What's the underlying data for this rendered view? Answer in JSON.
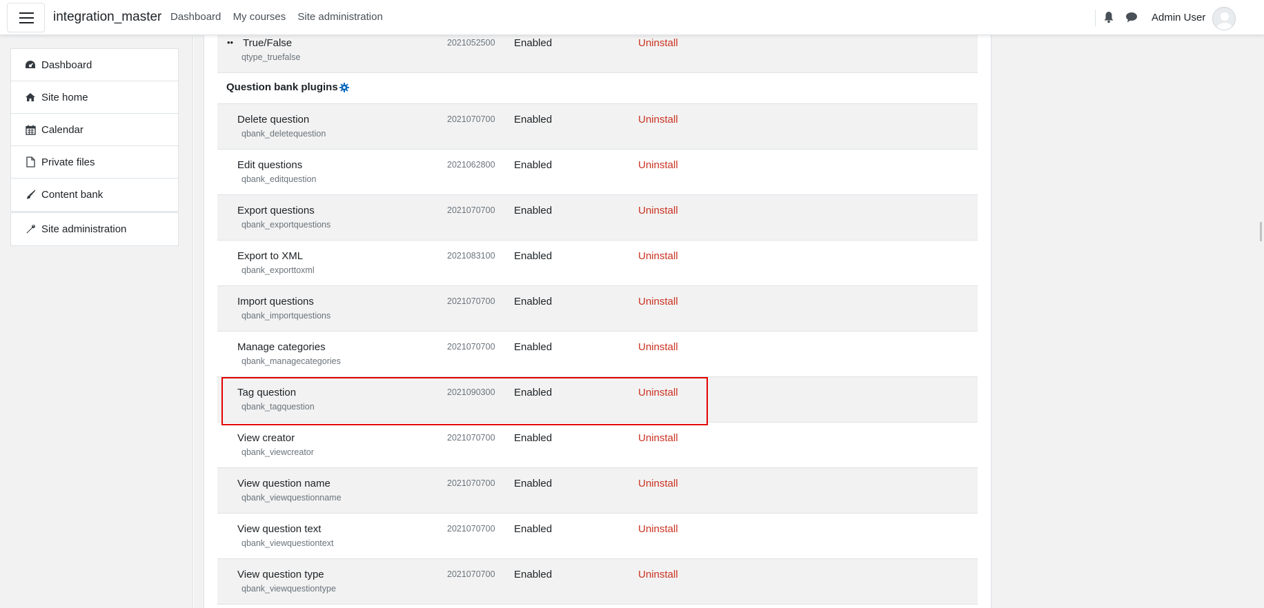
{
  "navbar": {
    "brand": "integration_master",
    "links": [
      "Dashboard",
      "My courses",
      "Site administration"
    ],
    "user_name": "Admin User",
    "icons": [
      "menu-icon",
      "bell-icon",
      "chat-icon",
      "avatar"
    ]
  },
  "drawer": {
    "group1": [
      {
        "label": "Dashboard",
        "icon": "dashboard-icon"
      },
      {
        "label": "Site home",
        "icon": "home-icon"
      },
      {
        "label": "Calendar",
        "icon": "calendar-icon"
      },
      {
        "label": "Private files",
        "icon": "file-icon"
      },
      {
        "label": "Content bank",
        "icon": "brush-icon"
      }
    ],
    "group2": [
      {
        "label": "Site administration",
        "icon": "wrench-icon"
      }
    ]
  },
  "top_row": {
    "bullet": "••",
    "name": "True/False",
    "component": "qtype_truefalse",
    "version": "2021052500",
    "status": "Enabled",
    "action": "Uninstall"
  },
  "section": {
    "title": "Question bank plugins"
  },
  "plugins": [
    {
      "name": "Delete question",
      "component": "qbank_deletequestion",
      "version": "2021070700",
      "status": "Enabled",
      "action": "Uninstall"
    },
    {
      "name": "Edit questions",
      "component": "qbank_editquestion",
      "version": "2021062800",
      "status": "Enabled",
      "action": "Uninstall"
    },
    {
      "name": "Export questions",
      "component": "qbank_exportquestions",
      "version": "2021070700",
      "status": "Enabled",
      "action": "Uninstall"
    },
    {
      "name": "Export to XML",
      "component": "qbank_exporttoxml",
      "version": "2021083100",
      "status": "Enabled",
      "action": "Uninstall"
    },
    {
      "name": "Import questions",
      "component": "qbank_importquestions",
      "version": "2021070700",
      "status": "Enabled",
      "action": "Uninstall"
    },
    {
      "name": "Manage categories",
      "component": "qbank_managecategories",
      "version": "2021070700",
      "status": "Enabled",
      "action": "Uninstall"
    },
    {
      "name": "Tag question",
      "component": "qbank_tagquestion",
      "version": "2021090300",
      "status": "Enabled",
      "action": "Uninstall"
    },
    {
      "name": "View creator",
      "component": "qbank_viewcreator",
      "version": "2021070700",
      "status": "Enabled",
      "action": "Uninstall"
    },
    {
      "name": "View question name",
      "component": "qbank_viewquestionname",
      "version": "2021070700",
      "status": "Enabled",
      "action": "Uninstall"
    },
    {
      "name": "View question text",
      "component": "qbank_viewquestiontext",
      "version": "2021070700",
      "status": "Enabled",
      "action": "Uninstall"
    },
    {
      "name": "View question type",
      "component": "qbank_viewquestiontype",
      "version": "2021070700",
      "status": "Enabled",
      "action": "Uninstall"
    }
  ],
  "colors": {
    "uninstall": "#ca3120",
    "highlight": "#e30000",
    "accent": "#0f6cbf"
  }
}
